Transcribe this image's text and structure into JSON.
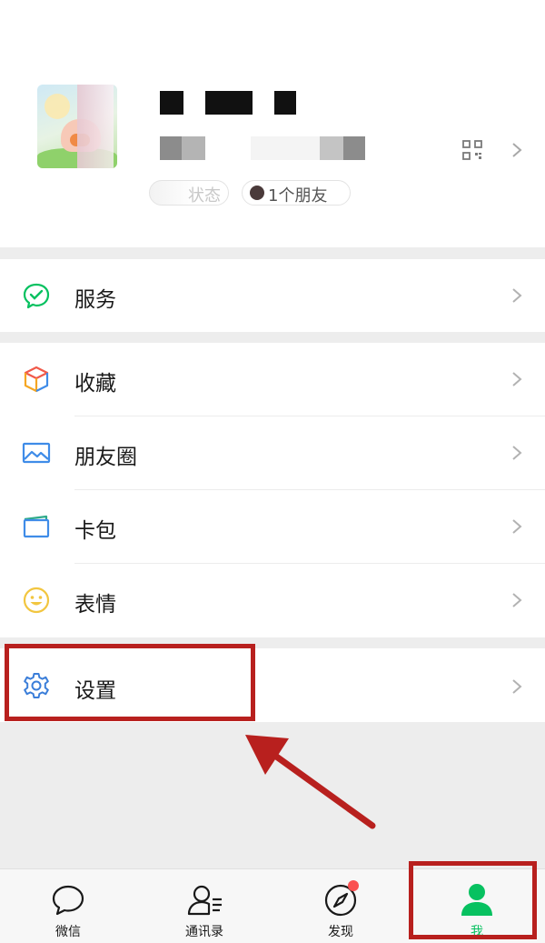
{
  "profile": {
    "friends_status": "1个朋友",
    "status_label": "状态"
  },
  "menu": {
    "services": "服务",
    "favorites": "收藏",
    "moments": "朋友圈",
    "cards": "卡包",
    "stickers": "表情",
    "settings": "设置"
  },
  "tabs": [
    {
      "label": "微信",
      "icon": "chat-bubble-icon"
    },
    {
      "label": "通讯录",
      "icon": "contacts-icon"
    },
    {
      "label": "发现",
      "icon": "compass-icon"
    },
    {
      "label": "我",
      "icon": "person-icon"
    }
  ],
  "colors": {
    "accent_green": "#07c160",
    "annotation_red": "#b8201e",
    "badge_red": "#fa5151",
    "settings_blue": "#3b7ed9",
    "favorites_orange": "#f5a623",
    "moments_blue": "#3f8ce8",
    "stickers_yellow": "#f2c640"
  }
}
